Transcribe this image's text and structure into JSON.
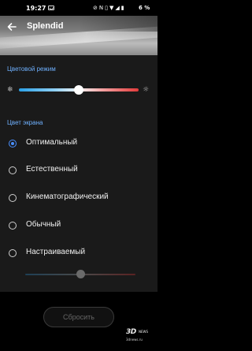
{
  "status_bar": {
    "time": "19:27",
    "icons": [
      "message-icon",
      "silent-icon",
      "nfc-icon",
      "vibrate-icon",
      "wifi-icon",
      "signal-icon",
      "battery-icon"
    ],
    "battery_text": "6 %"
  },
  "header": {
    "title": "Splendid"
  },
  "color_mode": {
    "label": "Цветовой режим",
    "temperature_level": 0.5
  },
  "screen_color": {
    "label": "Цвет экрана",
    "options": [
      {
        "label": "Оптимальный",
        "selected": true
      },
      {
        "label": "Естественный",
        "selected": false
      },
      {
        "label": "Кинематографический",
        "selected": false
      },
      {
        "label": "Обычный",
        "selected": false
      },
      {
        "label": "Настраиваемый",
        "selected": false
      }
    ],
    "custom_level": 0.5
  },
  "reset_label": "Сбросить",
  "watermark": {
    "brand": "3D",
    "news": "NEWS",
    "url": "3dnews.ru"
  },
  "colors": {
    "accent": "#4a90ff",
    "section_label": "#6fb1ff",
    "panel_bg": "#1a1a1a"
  }
}
